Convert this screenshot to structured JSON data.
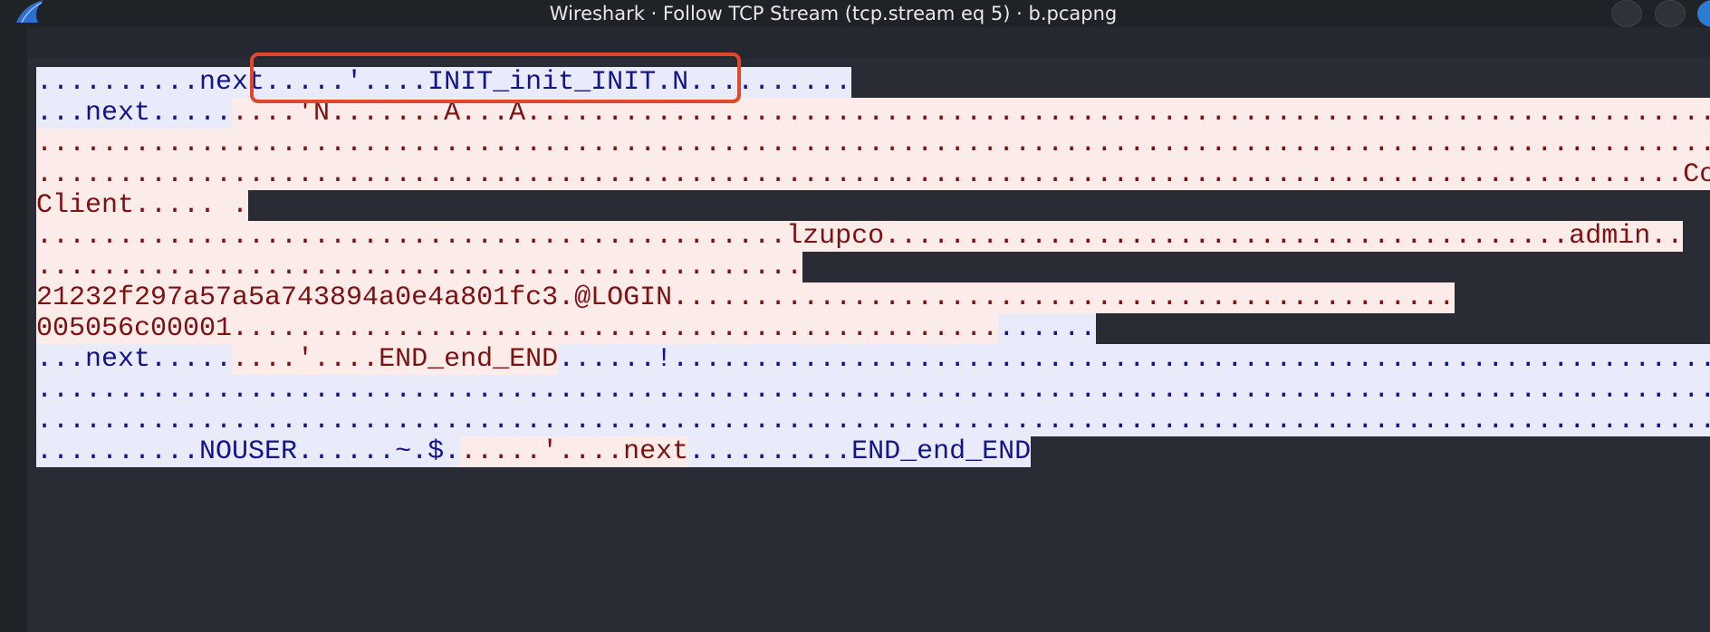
{
  "window": {
    "title": "Wireshark · Follow TCP Stream (tcp.stream eq 5) · b.pcapng",
    "app_icon": "wireshark-fin-icon",
    "controls": [
      "minimize-icon",
      "maximize-icon",
      "close-icon"
    ]
  },
  "colors": {
    "client_bg": "#e9ebfb",
    "client_fg": "#14148a",
    "server_bg": "#fbece9",
    "server_fg": "#7d1010",
    "highlight": "#e0472b"
  },
  "stream": {
    "lines": [
      [
        {
          "dir": "client",
          "text": "..........nex"
        },
        {
          "dir": "client",
          "text": "t.....'....INIT_init_INIT.N.........."
        }
      ],
      [
        {
          "dir": "client",
          "text": "...next....."
        },
        {
          "dir": "server",
          "text": "....'N.......A...A.................................................................................................."
        }
      ],
      [
        {
          "dir": "server",
          "text": "..........................................................................................................."
        }
      ],
      [
        {
          "dir": "server",
          "text": ".....................................................................................................Co"
        }
      ],
      [
        {
          "dir": "server",
          "text": "Client..... ."
        }
      ],
      [
        {
          "dir": "server",
          "text": "..............................................lzupco..........................................admin.."
        }
      ],
      [
        {
          "dir": "server",
          "text": "..............................................."
        }
      ],
      [
        {
          "dir": "server",
          "text": "21232f297a57a5a743894a0e4a801fc3.@LOGIN................................................"
        }
      ],
      [
        {
          "dir": "server",
          "text": "005056c00001..............................................."
        },
        {
          "dir": "client",
          "text": "......"
        }
      ],
      [
        {
          "dir": "client",
          "text": "...next....."
        },
        {
          "dir": "server",
          "text": "....'....END_end_END"
        },
        {
          "dir": "client",
          "text": "......!......................................................................................."
        }
      ],
      [
        {
          "dir": "client",
          "text": "..........................................................................................................."
        }
      ],
      [
        {
          "dir": "client",
          "text": "..........................................................................................................."
        }
      ],
      [
        {
          "dir": "client",
          "text": "..........NOUSER......~.$."
        },
        {
          "dir": "server",
          "text": ".....'....next"
        },
        {
          "dir": "client",
          "text": "..........END_end_END"
        }
      ]
    ]
  }
}
